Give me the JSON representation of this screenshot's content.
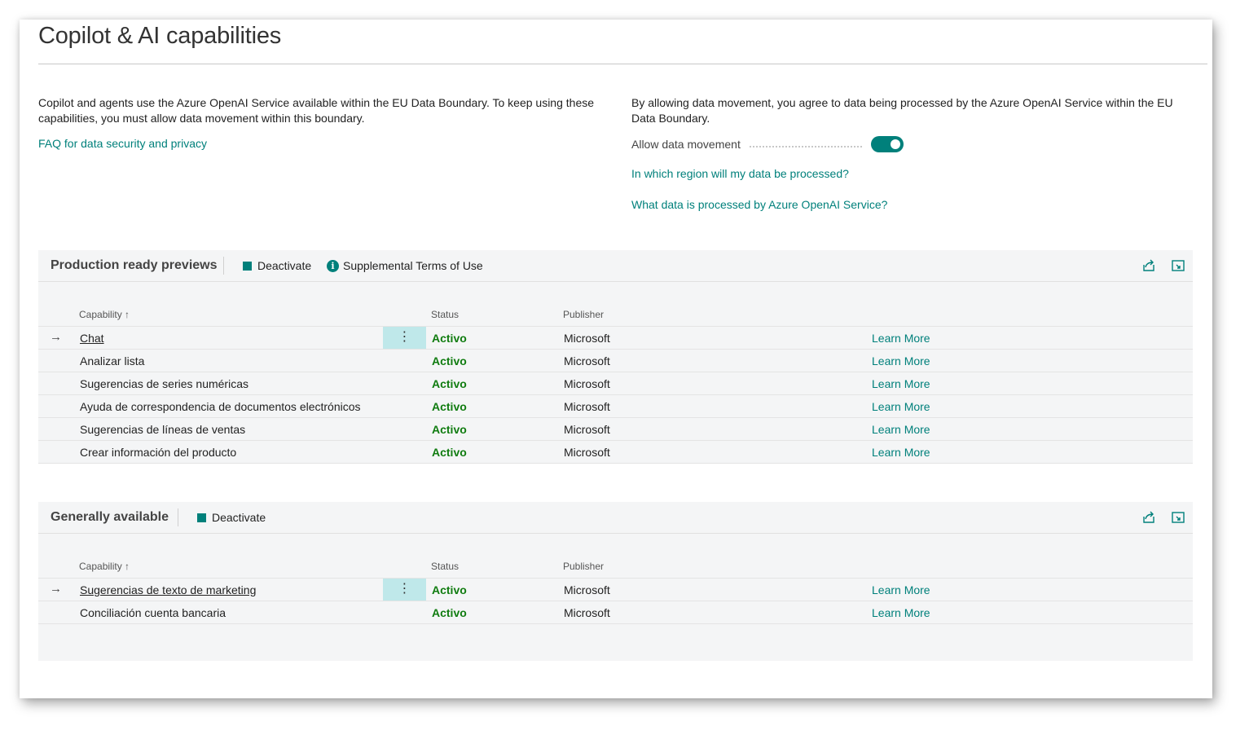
{
  "page": {
    "title": "Copilot & AI capabilities"
  },
  "intro": {
    "left_text": "Copilot and agents use the Azure OpenAI Service available within the EU Data Boundary. To keep using these capabilities, you must allow data movement within this boundary.",
    "faq_link": "FAQ for data security and privacy",
    "right_text": "By allowing data movement, you agree to data being processed by the Azure OpenAI Service within the EU Data Boundary.",
    "toggle_label": "Allow data movement",
    "toggle_on": true,
    "region_link": "In which region will my data be processed?",
    "data_link": "What data is processed by Azure OpenAI Service?"
  },
  "colors": {
    "accent": "#00807b",
    "status_active": "#107c10",
    "selected_cell": "#bfe8ea"
  },
  "preview_part": {
    "title": "Production ready previews",
    "deactivate_label": "Deactivate",
    "terms_label": "Supplemental Terms of Use",
    "columns": {
      "capability": "Capability ↑",
      "status": "Status",
      "publisher": "Publisher"
    },
    "rows": [
      {
        "name": "Chat",
        "status": "Activo",
        "publisher": "Microsoft",
        "learn": "Learn More"
      },
      {
        "name": "Analizar lista",
        "status": "Activo",
        "publisher": "Microsoft",
        "learn": "Learn More"
      },
      {
        "name": "Sugerencias de series numéricas",
        "status": "Activo",
        "publisher": "Microsoft",
        "learn": "Learn More"
      },
      {
        "name": "Ayuda de correspondencia de documentos electrónicos",
        "status": "Activo",
        "publisher": "Microsoft",
        "learn": "Learn More"
      },
      {
        "name": "Sugerencias de líneas de ventas",
        "status": "Activo",
        "publisher": "Microsoft",
        "learn": "Learn More"
      },
      {
        "name": "Crear información del producto",
        "status": "Activo",
        "publisher": "Microsoft",
        "learn": "Learn More"
      }
    ]
  },
  "ga_part": {
    "title": "Generally available",
    "deactivate_label": "Deactivate",
    "columns": {
      "capability": "Capability ↑",
      "status": "Status",
      "publisher": "Publisher"
    },
    "rows": [
      {
        "name": "Sugerencias de texto de marketing",
        "status": "Activo",
        "publisher": "Microsoft",
        "learn": "Learn More"
      },
      {
        "name": "Conciliación cuenta bancaria",
        "status": "Activo",
        "publisher": "Microsoft",
        "learn": "Learn More"
      }
    ]
  },
  "icons": {
    "row_arrow": "→",
    "row_menu": "⋮",
    "info": "i",
    "share": "share-icon",
    "expand": "expand-icon"
  }
}
